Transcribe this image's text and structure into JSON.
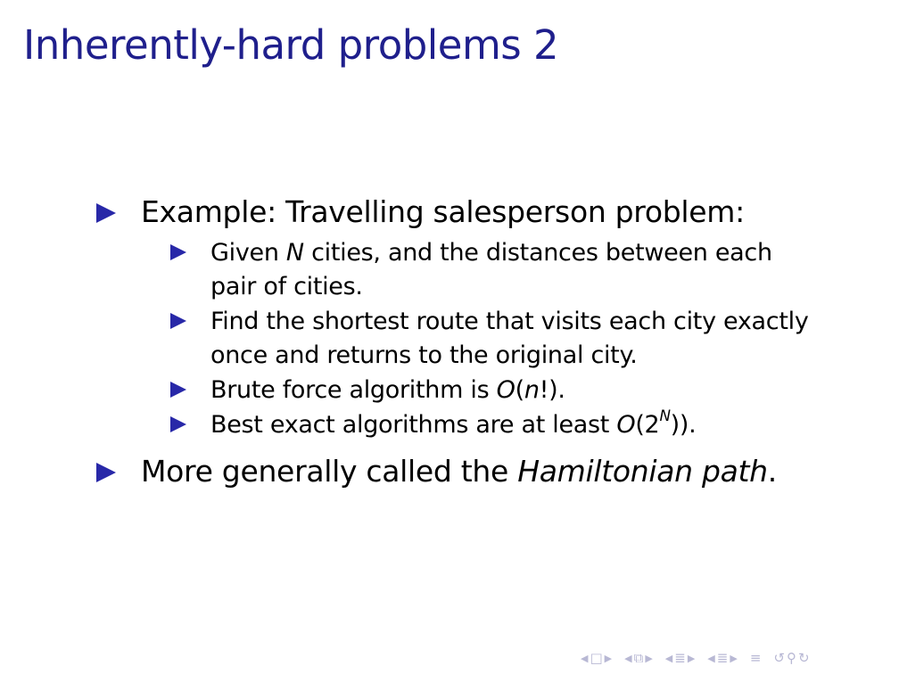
{
  "slide": {
    "title": "Inherently-hard problems 2",
    "item1": {
      "text": "Example: Travelling salesperson problem:"
    },
    "sub1": {
      "line1_a": "Given ",
      "line1_var": "N",
      "line1_b": " cities, and the distances between each",
      "line2": "pair of cities."
    },
    "sub2": {
      "line1": "Find the shortest route that visits each city exactly",
      "line2": "once and returns to the original city."
    },
    "sub3": {
      "text_a": "Brute force algorithm is ",
      "math_O": "O",
      "math_open": "(",
      "math_n": "n",
      "math_close": "!)",
      "text_b": "."
    },
    "sub4": {
      "text_a": "Best exact algorithms are at least ",
      "math_O": "O",
      "math_open": "(2",
      "math_exp": "N",
      "math_close": "))",
      "text_b": "."
    },
    "item2": {
      "text_a": "More generally called the ",
      "text_em": "Hamiltonian path",
      "text_b": "."
    }
  },
  "colors": {
    "title": "#1f1f8c",
    "bullet": "#2828a8",
    "nav": "#b8b8d4"
  },
  "nav": {
    "icons": [
      "arrow-left-icon",
      "frame-icon",
      "arrow-right-icon",
      "subsection-icon",
      "section-icon",
      "align-icon",
      "search-icon"
    ]
  }
}
